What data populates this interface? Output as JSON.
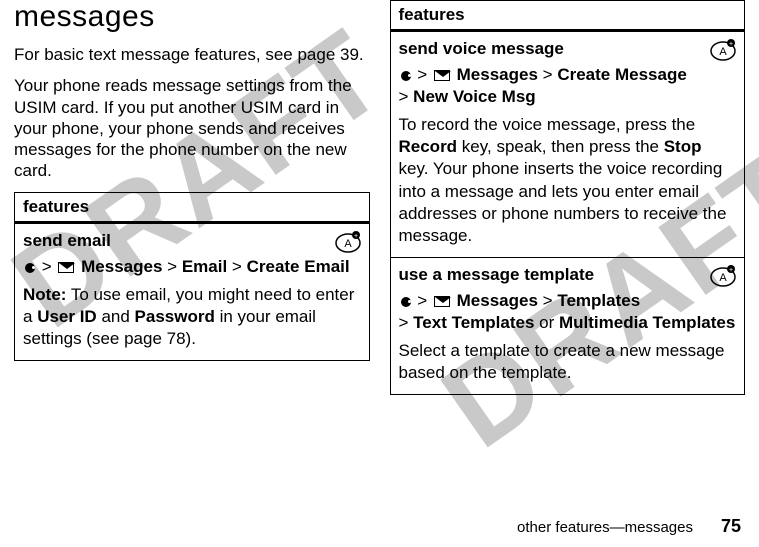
{
  "watermark": "DRAFT",
  "left": {
    "title": "messages",
    "intro1": "For basic text message features, see page 39.",
    "intro2": "Your phone reads message settings from the USIM card. If you put another USIM card in your phone, your phone sends and receives messages for the phone number on the new card.",
    "features_header": "features",
    "row1": {
      "title": "send email",
      "nav_parts": {
        "gt1": ">",
        "messages": "Messages",
        "gt2": ">",
        "email": "Email",
        "gt3": ">",
        "create": "Create Email"
      },
      "note_label": "Note:",
      "note_a": " To use email, you might need to enter a ",
      "note_b": "User ID",
      "note_c": " and ",
      "note_d": "Password",
      "note_e": " in your email settings (see page 78)."
    }
  },
  "right": {
    "features_header": "features",
    "row1": {
      "title": "send voice message",
      "nav_parts": {
        "gt1": ">",
        "messages": "Messages",
        "gt2": ">",
        "create": "Create Message",
        "gt3": ">",
        "newvoice": "New Voice Msg"
      },
      "body_a": "To record the voice message, press the ",
      "body_b": "Record",
      "body_c": " key, speak, then press the ",
      "body_d": "Stop",
      "body_e": " key. Your phone inserts the voice recording into a message and lets you enter email addresses or phone numbers to receive the message."
    },
    "row2": {
      "title": "use a message template",
      "nav_parts": {
        "gt1": ">",
        "messages": "Messages",
        "gt2": ">",
        "templates": "Templates",
        "gt3": ">",
        "text": "Text Templates",
        "or": " or ",
        "multi": "Multimedia Templates"
      },
      "body": "Select a template to create a new message based on the template."
    }
  },
  "footer": {
    "section": "other features—messages",
    "page": "75"
  }
}
